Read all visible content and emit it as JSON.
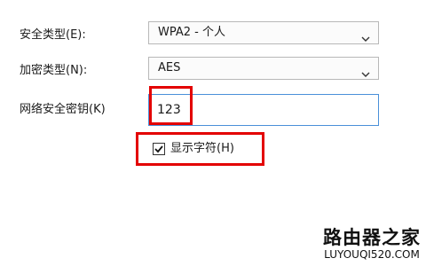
{
  "form": {
    "security_type": {
      "label": "安全类型(E):",
      "value": "WPA2 - 个人"
    },
    "encryption_type": {
      "label": "加密类型(N):",
      "value": "AES"
    },
    "network_key": {
      "label": "网络安全密钥(K)",
      "value": "123"
    },
    "show_characters": {
      "label": "显示字符(H)",
      "checked": true
    }
  },
  "watermark": {
    "title": "路由器之家",
    "url": "LUYOUQI520.COM"
  },
  "colors": {
    "highlight": "#e30000",
    "focus_border": "#4a90d9"
  }
}
